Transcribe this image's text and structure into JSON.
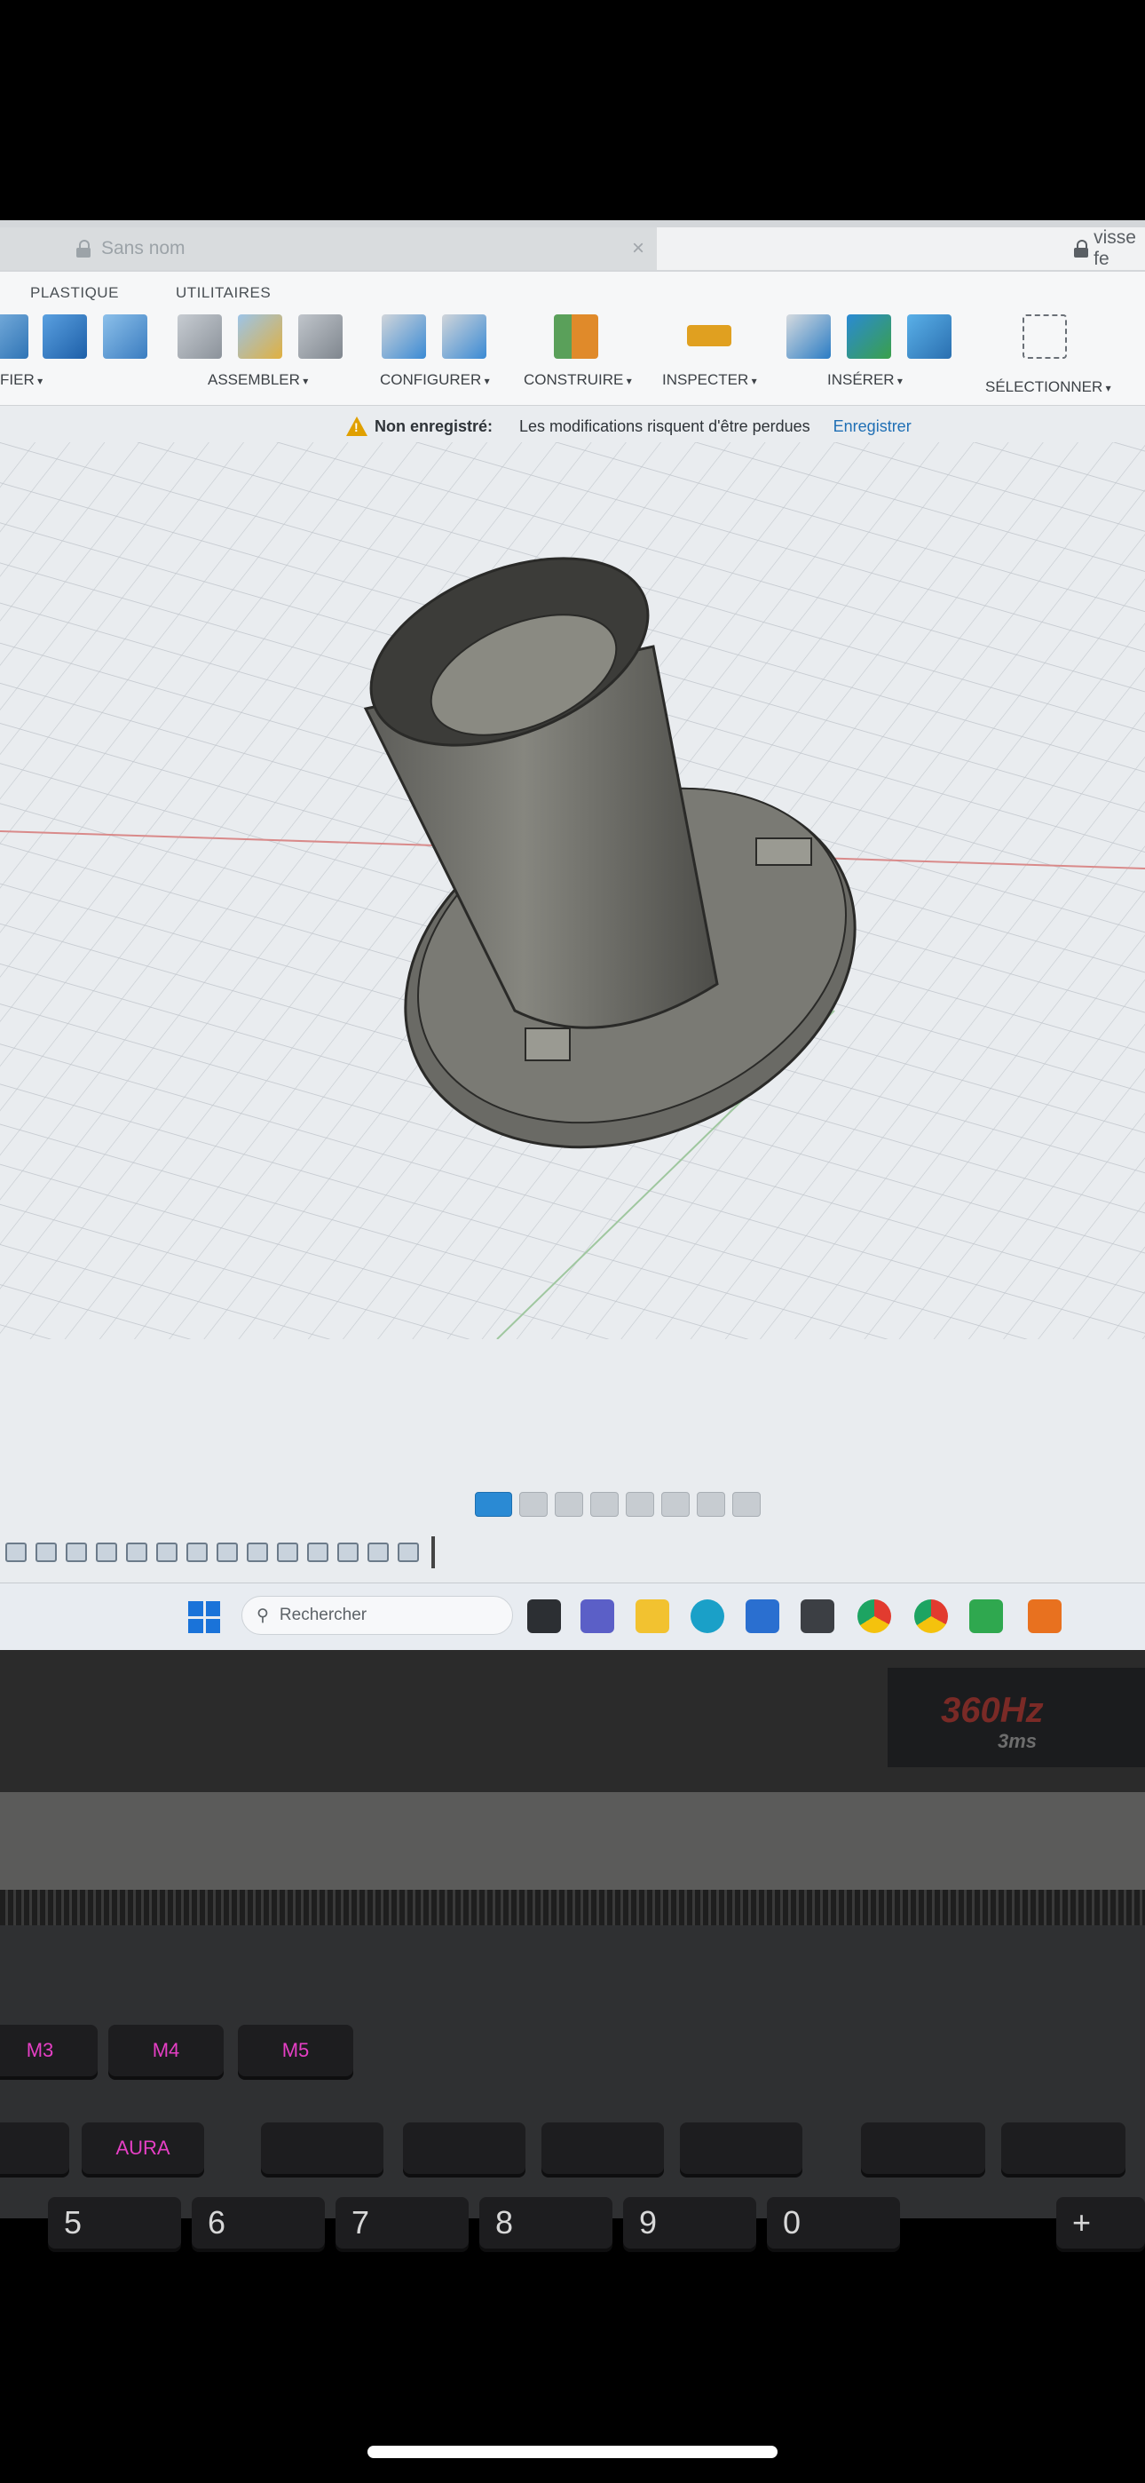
{
  "tabs": [
    {
      "title": "Sans nom",
      "locked": true,
      "active": false
    },
    {
      "title": "visse fe",
      "locked": true,
      "active": true
    }
  ],
  "ribbon": {
    "tabs": [
      "PLASTIQUE",
      "UTILITAIRES"
    ],
    "groups": [
      {
        "label": "FIER",
        "icon": "modify-icon"
      },
      {
        "label": "ASSEMBLER",
        "icon": "joint-icon"
      },
      {
        "label": "CONFIGURER",
        "icon": "configure-icon"
      },
      {
        "label": "CONSTRUIRE",
        "icon": "plane-icon"
      },
      {
        "label": "INSPECTER",
        "icon": "measure-icon"
      },
      {
        "label": "INSÉRER",
        "icon": "insert-icon"
      },
      {
        "label": "SÉLECTIONNER",
        "icon": "select-icon"
      }
    ]
  },
  "notice": {
    "label": "Non enregistré:",
    "message": "Les modifications risquent d'être perdues",
    "action": "Enregistrer"
  },
  "taskbar": {
    "search_placeholder": "Rechercher",
    "apps": [
      "file-explorer-icon",
      "teams-icon",
      "folder-icon",
      "edge-icon",
      "store-icon",
      "app-icon",
      "chrome-icon",
      "chrome-icon",
      "app-green-icon",
      "fusion-icon"
    ]
  },
  "laptop": {
    "badge_refresh": "360Hz",
    "badge_response": "3ms",
    "keys_macro": [
      "M3",
      "M4",
      "M5"
    ],
    "keys_fn": [
      "AURA"
    ],
    "keys_num": [
      "5",
      "6",
      "7",
      "8",
      "9",
      "0",
      "+"
    ]
  },
  "colors": {
    "accent": "#2a8ad4",
    "warning": "#e0a000",
    "link": "#1f6fb5",
    "key_glow": "#e63fc5"
  }
}
